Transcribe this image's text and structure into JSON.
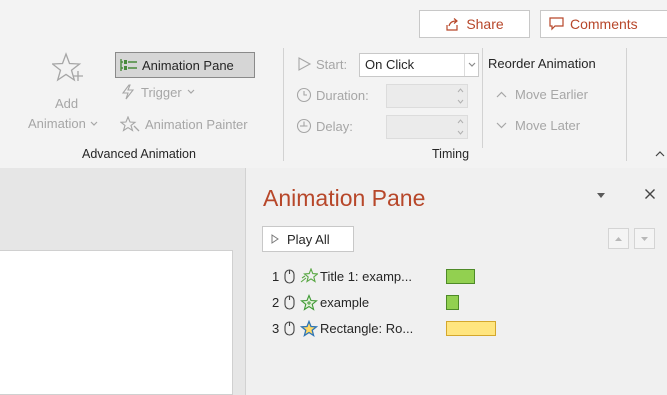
{
  "header": {
    "share_label": "Share",
    "comments_label": "Comments"
  },
  "advanced_animation": {
    "add_animation_label_1": "Add",
    "add_animation_label_2": "Animation",
    "animation_pane_label": "Animation Pane",
    "trigger_label": "Trigger",
    "animation_painter_label": "Animation Painter",
    "group_label": "Advanced Animation"
  },
  "timing": {
    "start_label": "Start:",
    "start_value": "On Click",
    "duration_label": "Duration:",
    "delay_label": "Delay:",
    "group_label": "Timing"
  },
  "reorder": {
    "title": "Reorder Animation",
    "move_earlier_label": "Move Earlier",
    "move_later_label": "Move Later"
  },
  "pane": {
    "title": "Animation Pane",
    "play_all_label": "Play All",
    "items": [
      {
        "num": "1",
        "name": "Title 1: examp...",
        "effect_icon": "fly-in-star-icon",
        "bar_color": "#92d050",
        "bar_border": "#4e8a28"
      },
      {
        "num": "2",
        "name": "example",
        "effect_icon": "sparkle-star-icon",
        "bar_color": "#92d050",
        "bar_border": "#4e8a28"
      },
      {
        "num": "3",
        "name": "Rectangle: Ro...",
        "effect_icon": "emphasis-star-icon",
        "bar_color": "#ffe57f",
        "bar_border": "#d4a72c"
      }
    ]
  },
  "colors": {
    "accent": "#b7472a",
    "ribbon_bg": "#f3f3f3",
    "pane_bg": "#f0f0f0"
  }
}
